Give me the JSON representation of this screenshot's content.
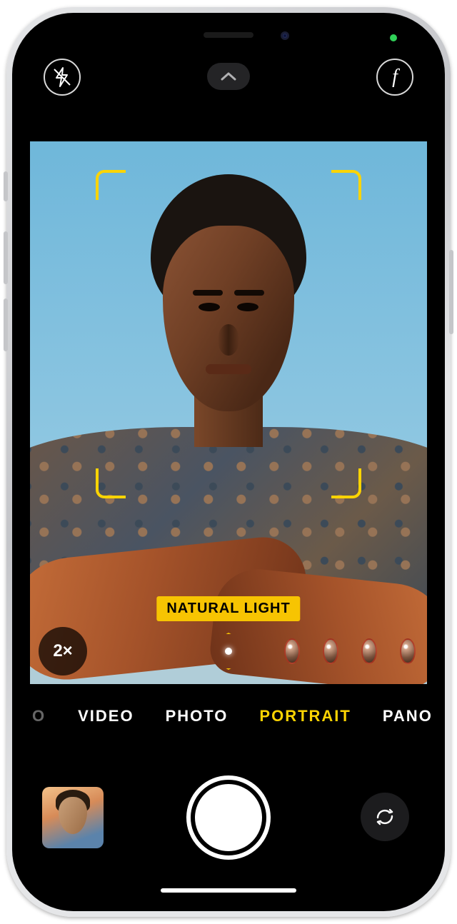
{
  "topbar": {
    "flash_state": "off",
    "depth_label": "f"
  },
  "viewfinder": {
    "zoom_label": "2×",
    "lighting_label": "NATURAL LIGHT"
  },
  "modes": {
    "prev_partial": "O",
    "items": [
      "VIDEO",
      "PHOTO",
      "PORTRAIT",
      "PANO"
    ],
    "selected_index": 2
  }
}
